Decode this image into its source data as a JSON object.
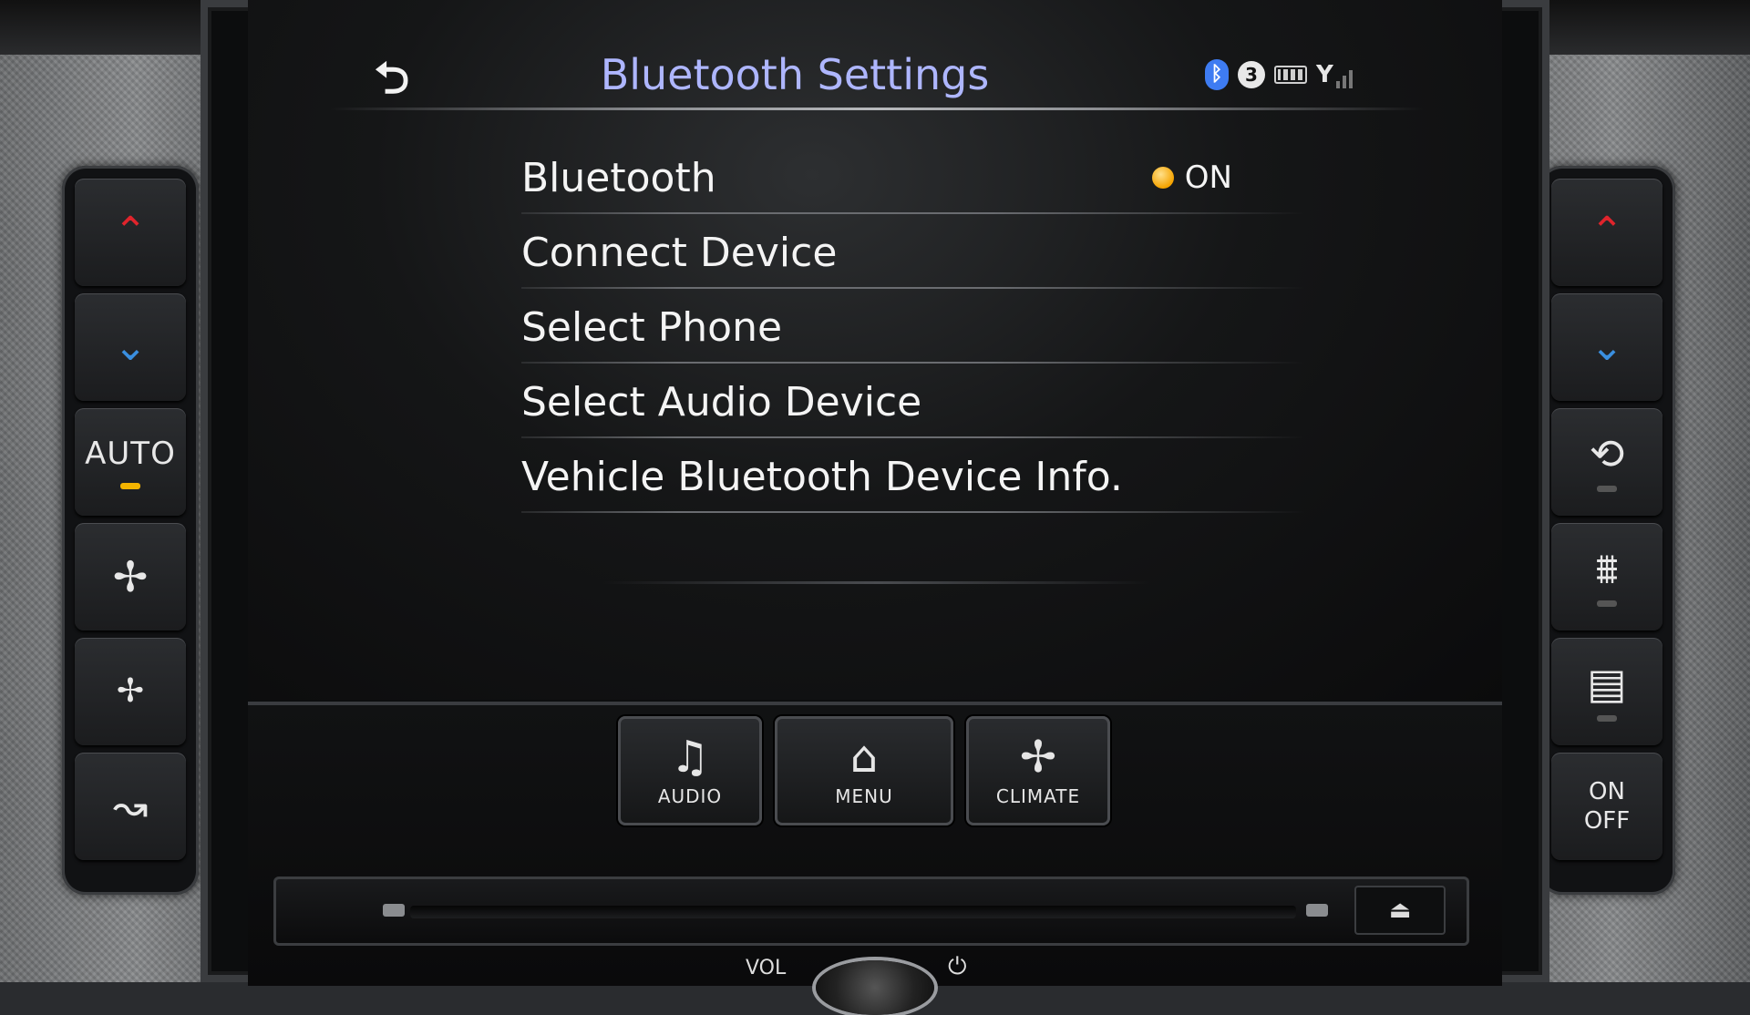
{
  "header": {
    "title": "Bluetooth Settings",
    "back_icon": "back-arrow-icon",
    "status": {
      "bluetooth_icon": "bluetooth-icon",
      "bluetooth_glyph": "ᛒ",
      "device_count": "3",
      "battery_icon": "battery-icon",
      "signal_icon": "signal-icon",
      "signal_glyph": "Y"
    }
  },
  "menu": {
    "items": [
      {
        "label": "Bluetooth",
        "state": "ON"
      },
      {
        "label": "Connect Device"
      },
      {
        "label": "Select Phone"
      },
      {
        "label": "Select Audio Device"
      },
      {
        "label": "Vehicle Bluetooth Device Info."
      }
    ]
  },
  "hard_buttons": {
    "audio": {
      "label": "AUDIO",
      "icon": "music-note-icon",
      "glyph": "♫"
    },
    "menu": {
      "label": "MENU",
      "icon": "home-icon",
      "glyph": "⌂"
    },
    "climate": {
      "label": "CLIMATE",
      "icon": "fan-icon",
      "glyph": "✢"
    }
  },
  "left_controls": {
    "temp_up_glyph": "⌃",
    "temp_down_glyph": "⌄",
    "auto_label": "AUTO",
    "fan_high_glyph": "✢",
    "fan_low_glyph": "✢",
    "airflow_glyph": "↝"
  },
  "right_controls": {
    "temp_up_glyph": "⌃",
    "temp_down_glyph": "⌄",
    "recirc_glyph": "⟲",
    "front_defrost_glyph": "⩩",
    "rear_defrost_glyph": "▤",
    "on_label": "ON",
    "off_label": "OFF"
  },
  "bottom": {
    "vol_label": "VOL",
    "power_glyph": "⏻",
    "eject_glyph": "⏏"
  },
  "colors": {
    "title": "#aeb6ff",
    "bluetooth_on_dot": "#f5a300",
    "temp_up": "#e0242c",
    "temp_down": "#3a8fe0",
    "auto_indicator": "#f4b400"
  }
}
